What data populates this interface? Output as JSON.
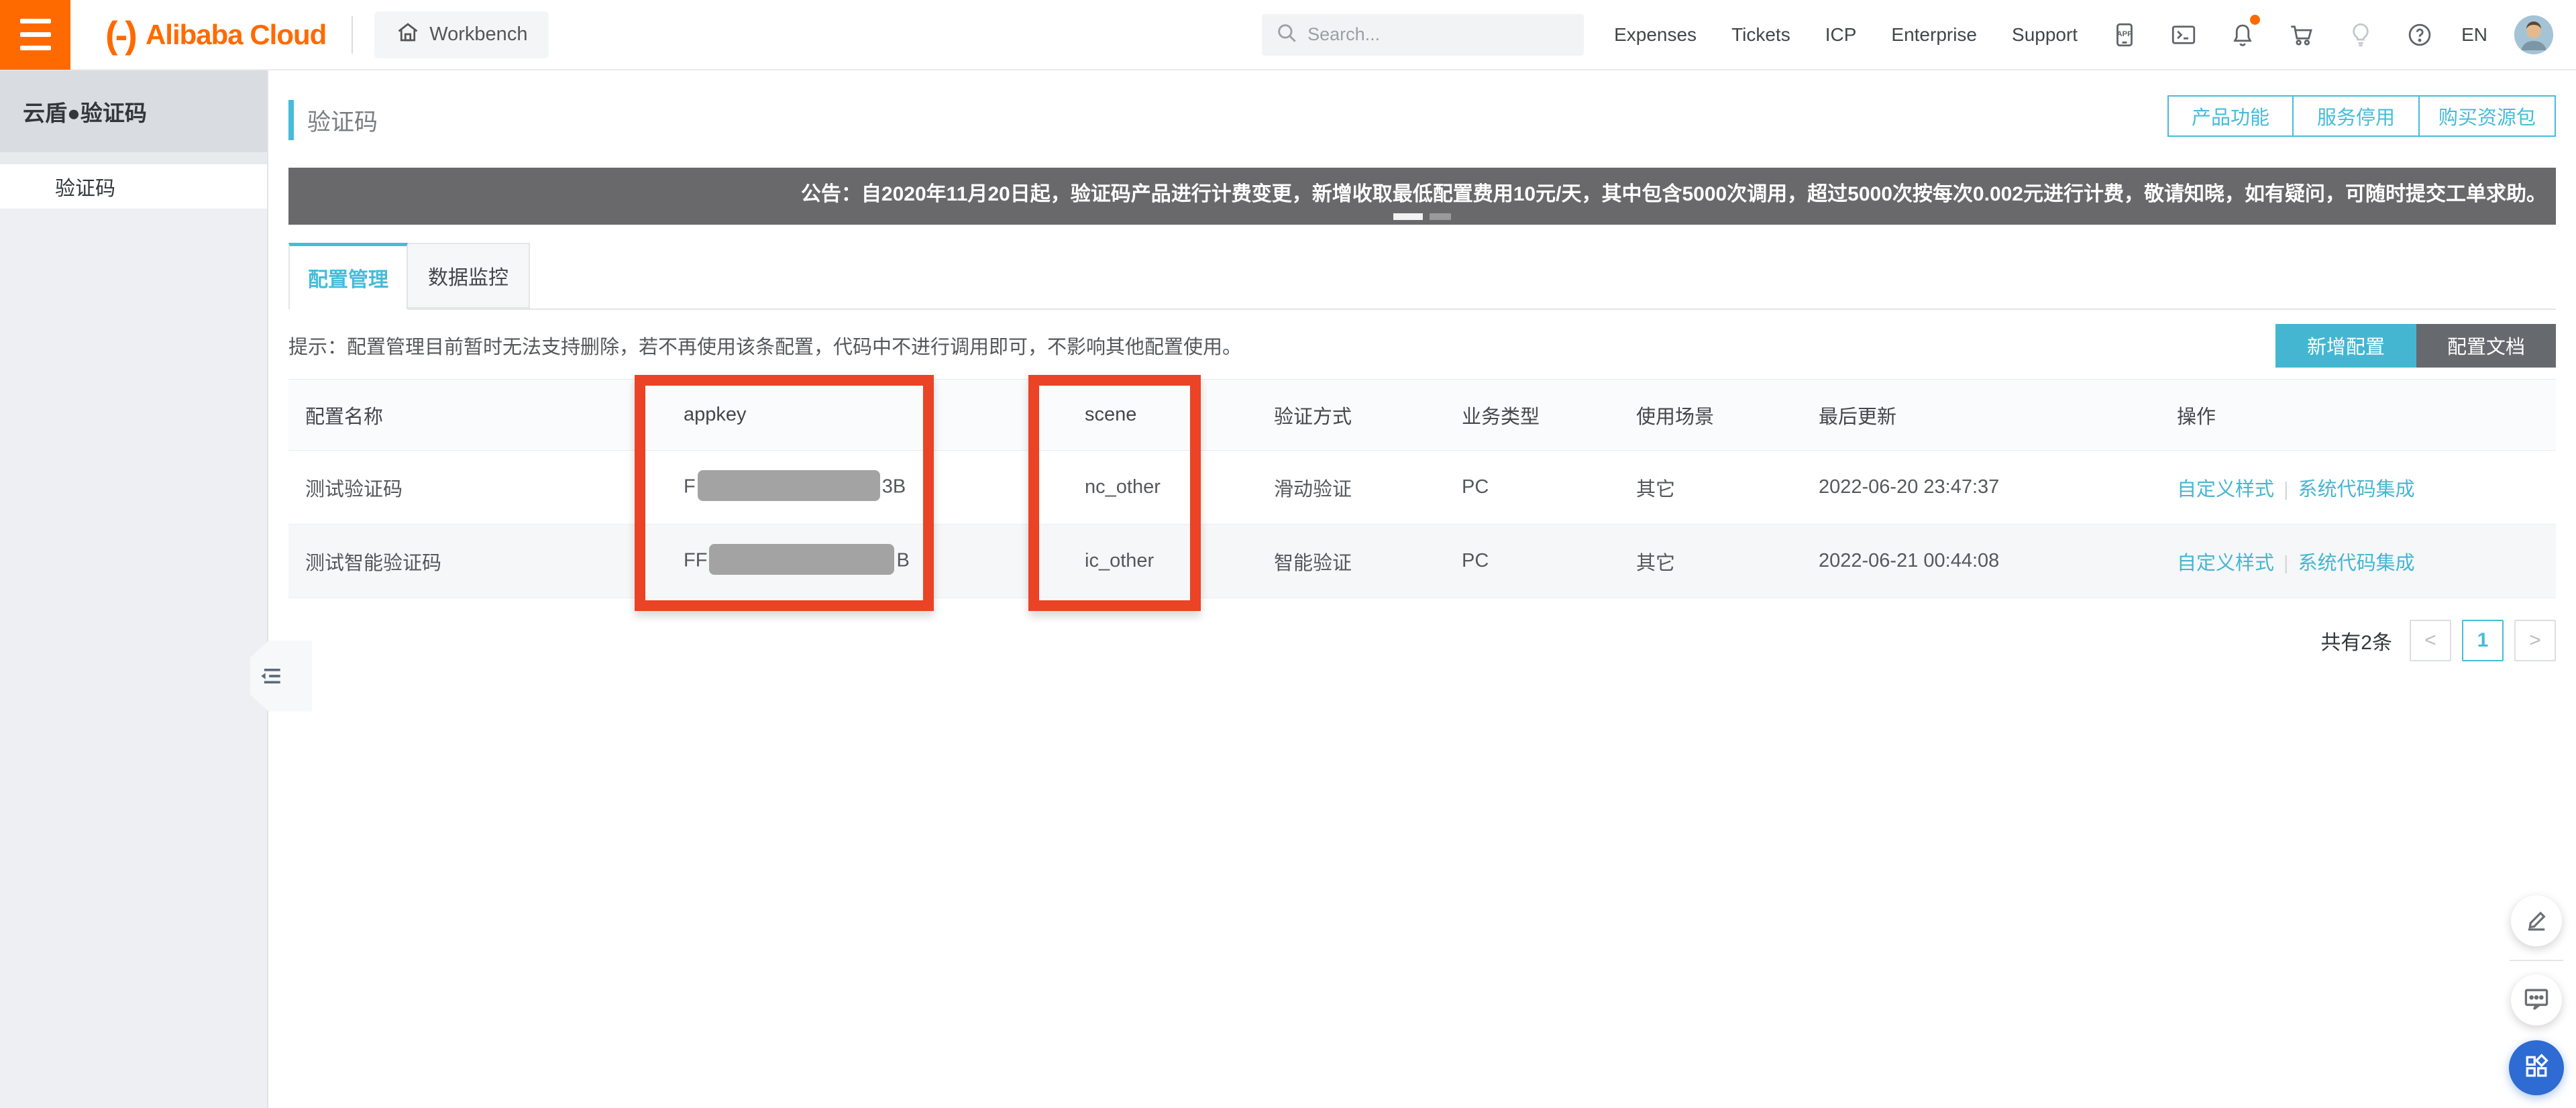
{
  "colors": {
    "accent_teal": "#45bcd9",
    "brand_orange": "#ff6a00",
    "annotation_red": "#ea4326",
    "announce_bg": "#69696b",
    "float_blue": "#2e6bd2"
  },
  "header": {
    "logo_mark": "(-)",
    "logo_text": "Alibaba Cloud",
    "workbench_label": "Workbench",
    "search_placeholder": "Search...",
    "nav": [
      "Expenses",
      "Tickets",
      "ICP",
      "Enterprise",
      "Support"
    ],
    "app_icon_label": "APP",
    "lang": "EN"
  },
  "sidebar": {
    "title": "云盾●验证码",
    "items": [
      {
        "label": "验证码",
        "active": true
      }
    ]
  },
  "page": {
    "title": "验证码",
    "header_buttons": [
      "产品功能",
      "服务停用",
      "购买资源包"
    ],
    "announcement": "公告：自2020年11月20日起，验证码产品进行计费变更，新增收取最低配置费用10元/天，其中包含5000次调用，超过5000次按每次0.002元进行计费，敬请知晓，如有疑问，可随时提交工单求助。",
    "tabs": [
      {
        "label": "配置管理",
        "active": true
      },
      {
        "label": "数据监控",
        "active": false
      }
    ],
    "tip": "提示：配置管理目前暂时无法支持删除，若不再使用该条配置，代码中不进行调用即可，不影响其他配置使用。",
    "actions": {
      "add": "新增配置",
      "docs": "配置文档"
    }
  },
  "table": {
    "columns": [
      "配置名称",
      "appkey",
      "scene",
      "验证方式",
      "业务类型",
      "使用场景",
      "最后更新",
      "操作"
    ],
    "rows": [
      {
        "name": "测试验证码",
        "appkey_prefix": "F",
        "appkey_suffix": "3B",
        "appkey_redacted": true,
        "scene": "nc_other",
        "verify_type": "滑动验证",
        "biz_type": "PC",
        "usage": "其它",
        "updated": "2022-06-20 23:47:37",
        "actions": [
          "自定义样式",
          "系统代码集成"
        ]
      },
      {
        "name": "测试智能验证码",
        "appkey_prefix": "FF",
        "appkey_suffix": "B",
        "appkey_redacted": true,
        "scene": "ic_other",
        "verify_type": "智能验证",
        "biz_type": "PC",
        "usage": "其它",
        "updated": "2022-06-21 00:44:08",
        "actions": [
          "自定义样式",
          "系统代码集成"
        ]
      }
    ],
    "total_label": "共有2条",
    "pagination": {
      "prev": "<",
      "current_page": "1",
      "next": ">"
    }
  }
}
